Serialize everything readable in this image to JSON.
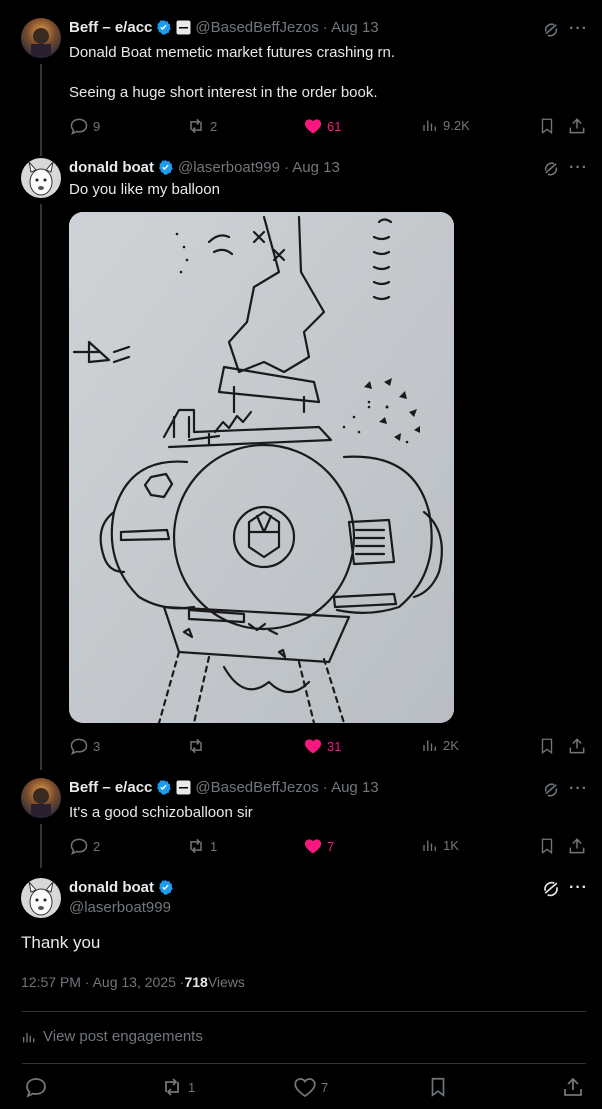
{
  "posts": [
    {
      "name": "Beff – e/acc",
      "handle": "@BasedBeffJezos",
      "date": "· Aug 13",
      "text_lines": [
        "Donald Boat memetic market futures crashing rn.",
        "Seeing a huge short interest in the order book."
      ],
      "replies": "9",
      "reposts": "2",
      "likes": "61",
      "views": "9.2K"
    },
    {
      "name": "donald boat",
      "handle": "@laserboat999",
      "date": "· Aug 13",
      "text": "Do you like my balloon",
      "replies": "3",
      "reposts": "",
      "likes": "31",
      "views": "2K"
    },
    {
      "name": "Beff – e/acc",
      "handle": "@BasedBeffJezos",
      "date": "· Aug 13",
      "text": "It's a good schizoballoon sir",
      "replies": "2",
      "reposts": "1",
      "likes": "7",
      "views": "1K"
    }
  ],
  "main_post": {
    "name": "donald boat",
    "handle": "@laserboat999",
    "text": "Thank you",
    "time": "12:57 PM · Aug 13, 2025 · ",
    "views_count": "718",
    "views_label": " Views",
    "engagements": "View post engagements",
    "reposts": "1",
    "likes": "7"
  },
  "colors": {
    "accent": "#1d9bf0",
    "like": "#f91880",
    "muted": "#71767b"
  }
}
